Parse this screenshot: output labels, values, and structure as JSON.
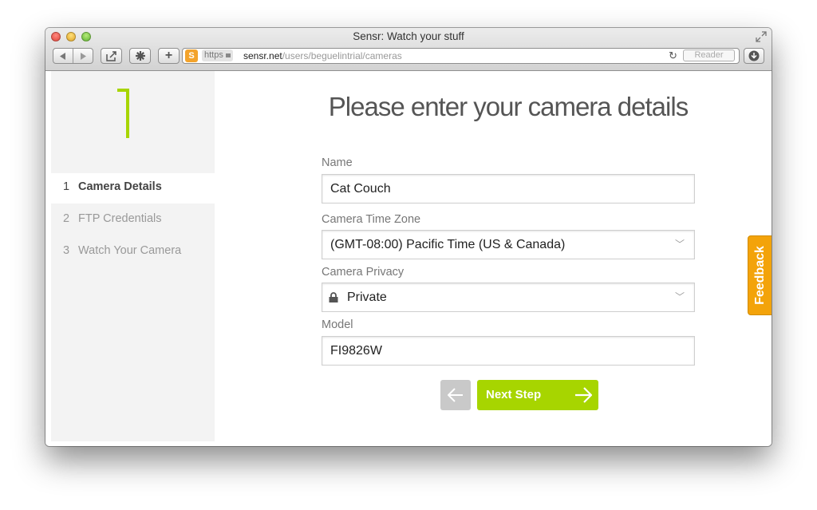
{
  "window": {
    "title": "Sensr: Watch your stuff"
  },
  "toolbar": {
    "url_scheme": "https",
    "url_host": "sensr.net",
    "url_path": "/users/beguelintrial/cameras",
    "reader_label": "Reader",
    "site_badge": "S",
    "add_label": "+"
  },
  "sidebar": {
    "steps": [
      {
        "num": "1",
        "label": "Camera Details",
        "active": true
      },
      {
        "num": "2",
        "label": "FTP Credentials",
        "active": false
      },
      {
        "num": "3",
        "label": "Watch Your Camera",
        "active": false
      }
    ]
  },
  "form": {
    "heading": "Please enter your camera details",
    "name_label": "Name",
    "name_value": "Cat Couch",
    "timezone_label": "Camera Time Zone",
    "timezone_value": "(GMT-08:00) Pacific Time (US & Canada)",
    "privacy_label": "Camera Privacy",
    "privacy_value": "Private",
    "model_label": "Model",
    "model_value": "FI9826W",
    "next_label": "Next Step"
  },
  "feedback_label": "Feedback",
  "colors": {
    "accent": "#a7d500",
    "feedback": "#f3a30a"
  }
}
